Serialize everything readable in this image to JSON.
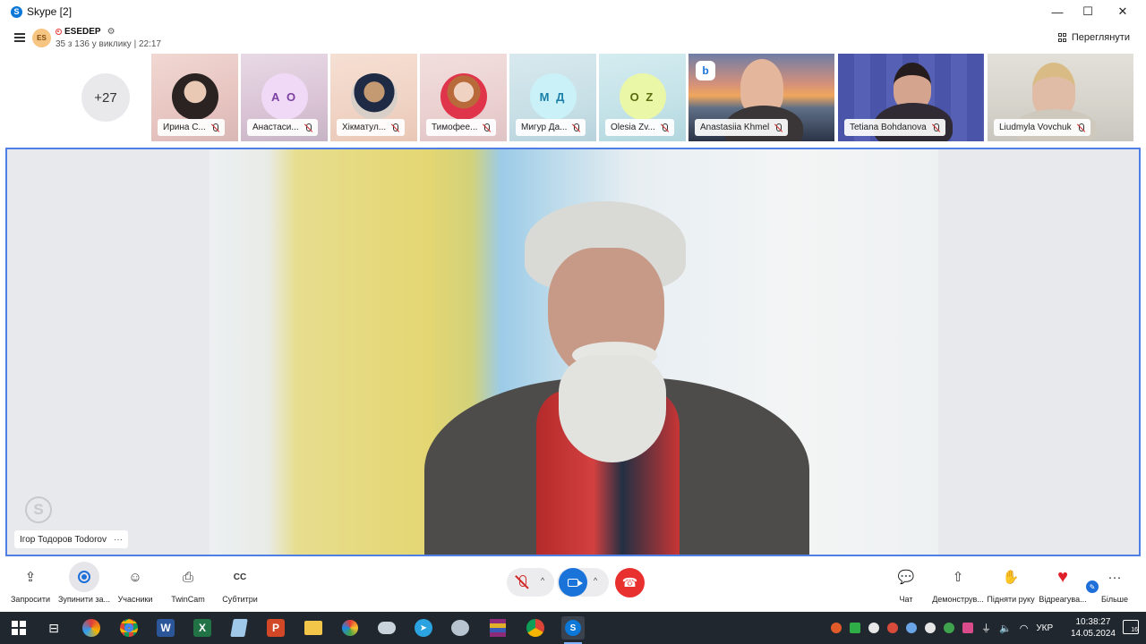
{
  "window": {
    "title": "Skype [2]",
    "app_icon": "S",
    "minimize_icon": "—",
    "maximize_icon": "☐",
    "close_icon": "✕"
  },
  "header": {
    "menu_icon": "hamburger-icon",
    "group_avatar": "ES",
    "group_name": "ESEDEP",
    "settings_icon": "⚙",
    "call_info": "35 з 136 у виклику | 22:17",
    "view_label": "Переглянути"
  },
  "strip": {
    "more_count": "+27",
    "participants": [
      {
        "name": "Ирина С...",
        "type": "photo"
      },
      {
        "name": "Анастаси...",
        "type": "initials",
        "initials": "А О",
        "color": "#7a3fa0",
        "bg": "#f0d9f7"
      },
      {
        "name": "Хікматул...",
        "type": "photo"
      },
      {
        "name": "Тимофее...",
        "type": "photo"
      },
      {
        "name": "Мигур Да...",
        "type": "initials",
        "initials": "М Д",
        "color": "#1a7fa8",
        "bg": "#c9f1f7"
      },
      {
        "name": "Olesia Zv...",
        "type": "initials",
        "initials": "O Z",
        "color": "#5a6b10",
        "bg": "#eaf7a6"
      },
      {
        "name": "Anastasiia Khmel",
        "type": "video"
      },
      {
        "name": "Tetiana Bohdanova",
        "type": "video"
      },
      {
        "name": "Liudmyla Vovchuk",
        "type": "video"
      }
    ]
  },
  "stage": {
    "speaker_name": "Ігор Тодоров Todorov",
    "more_icon": "···",
    "watermark": "S"
  },
  "toolbar": {
    "left": [
      {
        "label": "Запросити",
        "icon": "⇪"
      },
      {
        "label": "Зупинити за...",
        "icon": "record-icon"
      },
      {
        "label": "Учасники",
        "icon": "☺"
      },
      {
        "label": "TwinCam",
        "icon": "⎙"
      },
      {
        "label": "Субтитри",
        "icon": "CC"
      }
    ],
    "right": [
      {
        "label": "Чат",
        "icon": "💬"
      },
      {
        "label": "Демонструв...",
        "icon": "⇧"
      },
      {
        "label": "Підняти руку",
        "icon": "✋"
      },
      {
        "label": "Відреагува...",
        "icon": "♥"
      },
      {
        "label": "Більше",
        "icon": "···"
      }
    ],
    "chevron": "^",
    "end_icon": "☎"
  },
  "taskbar": {
    "apps": [
      "task-view",
      "skype-alt",
      "chrome",
      "word",
      "excel",
      "notepad",
      "powerpoint",
      "file-explorer",
      "paint",
      "clouds",
      "telegram",
      "palette",
      "winrar",
      "chrome-profile",
      "skype"
    ],
    "lang": "УКР",
    "time": "10:38:27",
    "date": "14.05.2024",
    "notifications": "16"
  },
  "colors": {
    "accent": "#1a73d9",
    "stage_border": "#4e7ee6",
    "end_call": "#e8312f",
    "taskbar": "#20272e"
  }
}
